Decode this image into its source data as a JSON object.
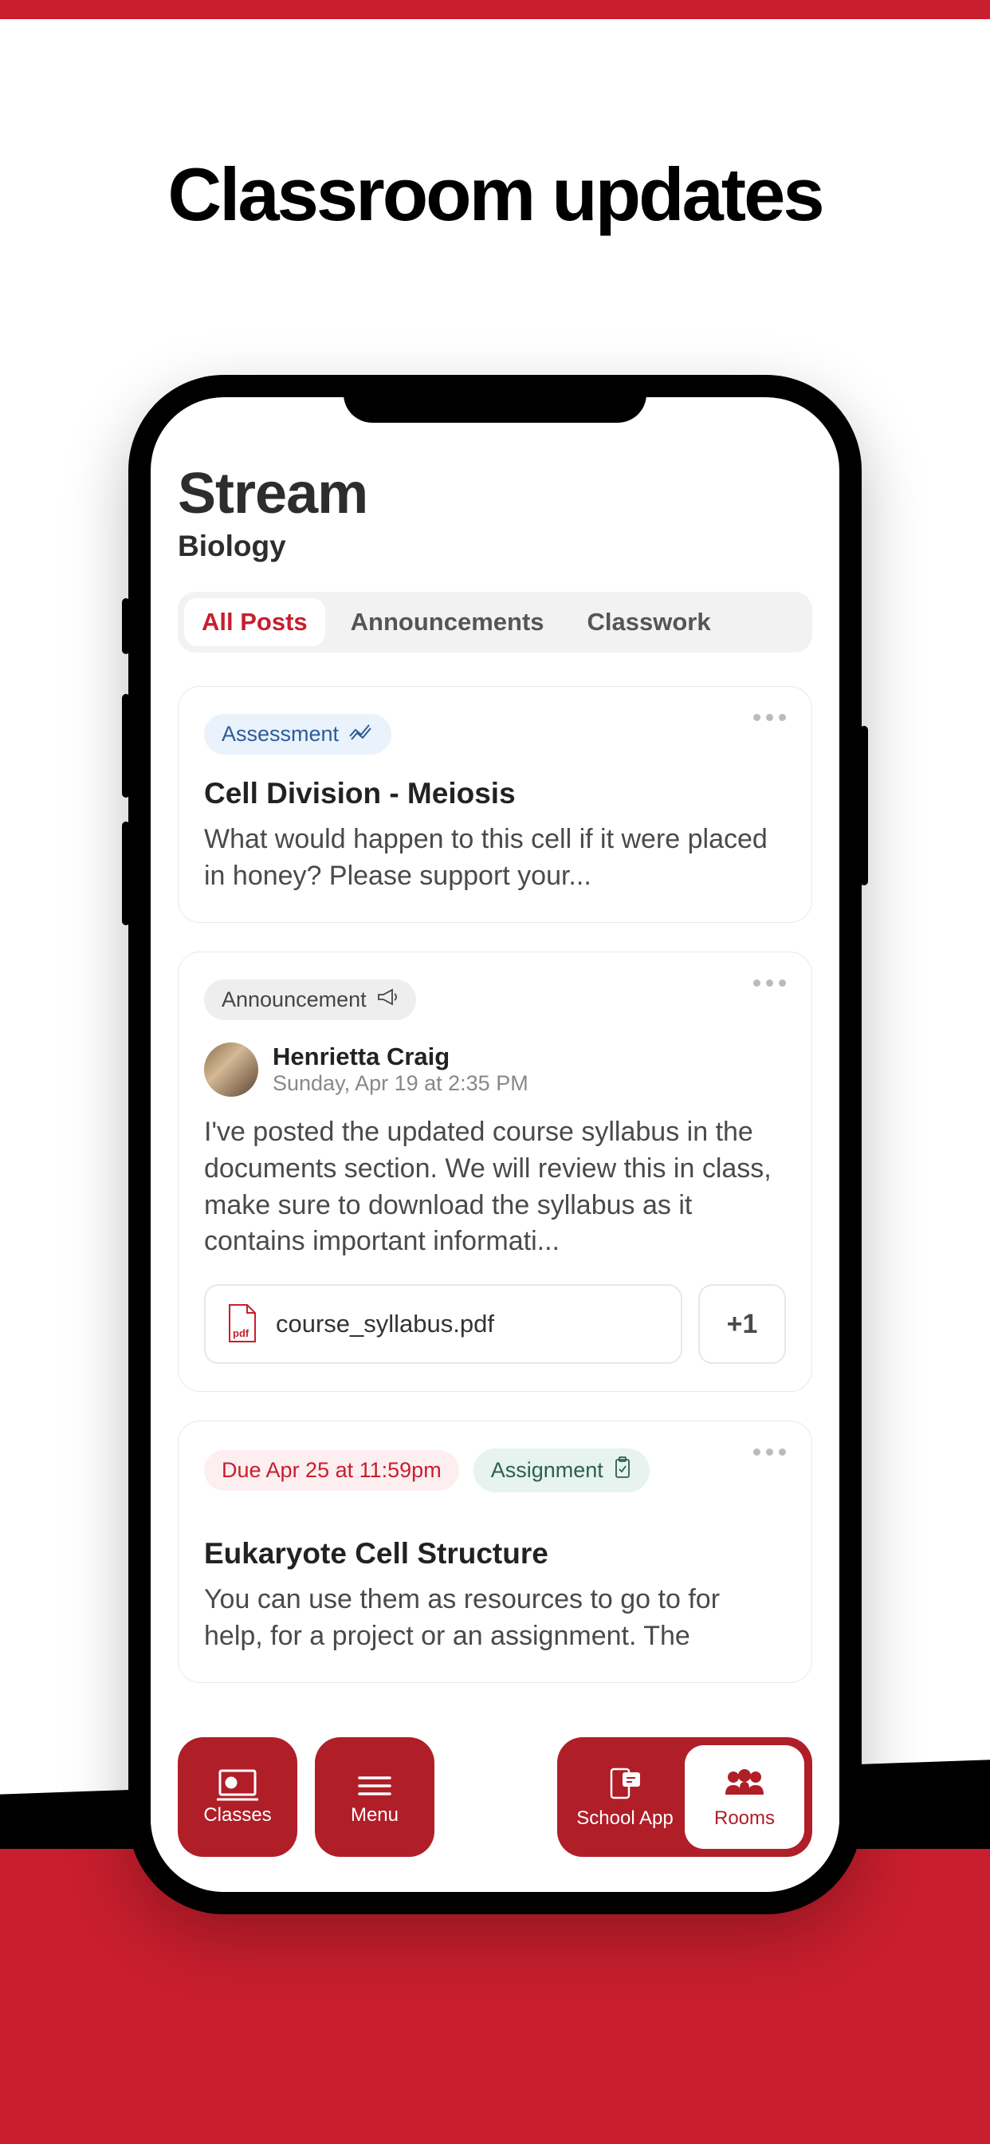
{
  "headline": "Classroom updates",
  "stream": {
    "title": "Stream",
    "subtitle": "Biology",
    "tabs": [
      "All Posts",
      "Announcements",
      "Classwork"
    ],
    "active_tab": 0
  },
  "posts": [
    {
      "badge_type": "assessment",
      "badge_label": "Assessment",
      "title": "Cell Division - Meiosis",
      "body": "What would happen to this cell if it were placed in honey? Please support your..."
    },
    {
      "badge_type": "announcement",
      "badge_label": "Announcement",
      "author": "Henrietta Craig",
      "timestamp": "Sunday, Apr 19 at 2:35 PM",
      "body": "I've posted the updated course syllabus in the documents section. We will review this in class, make sure to download the syllabus as it contains important informati...",
      "attachment_name": "course_syllabus.pdf",
      "attachment_more": "+1"
    },
    {
      "due_label": "Due Apr 25 at 11:59pm",
      "badge_type": "assignment",
      "badge_label": "Assignment",
      "title": "Eukaryote Cell Structure",
      "body": "You can use them as resources to go to for help, for a project or an assignment. The"
    }
  ],
  "nav": {
    "classes": "Classes",
    "menu": "Menu",
    "school_app": "School App",
    "rooms": "Rooms"
  },
  "colors": {
    "accent": "#c81e2d",
    "nav": "#b01e28"
  }
}
